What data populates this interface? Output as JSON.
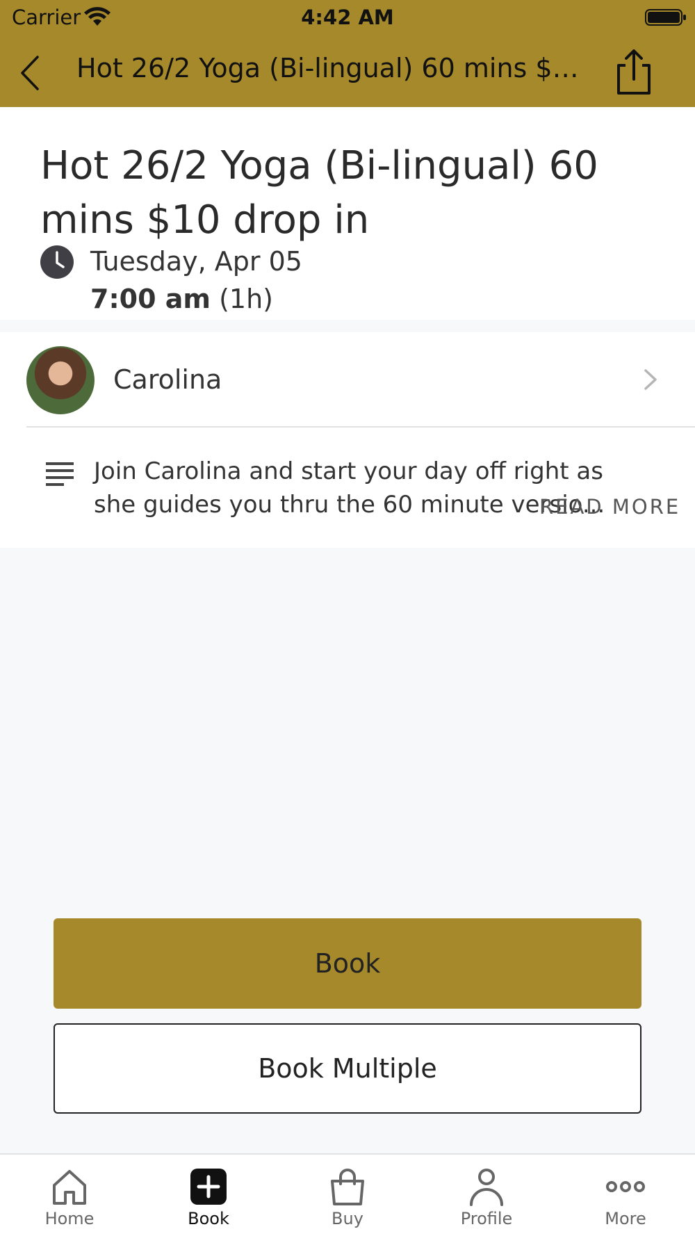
{
  "status_bar": {
    "carrier": "Carrier",
    "time": "4:42 AM"
  },
  "nav": {
    "title": "Hot 26/2 Yoga (Bi-lingual) 60 mins $10..."
  },
  "class": {
    "title": "Hot 26/2 Yoga (Bi-lingual) 60 mins $10 drop in",
    "date": "Tuesday, Apr 05",
    "time": "7:00 am",
    "duration": "(1h)"
  },
  "instructor": {
    "name": "Carolina"
  },
  "description": {
    "text": "Join Carolina and start your day off right as she guides you thru the 60 minute versio...",
    "read_more": "READ MORE"
  },
  "actions": {
    "book": "Book",
    "book_multiple": "Book Multiple"
  },
  "tabs": [
    {
      "label": "Home",
      "icon": "home-icon"
    },
    {
      "label": "Book",
      "icon": "book-plus-icon"
    },
    {
      "label": "Buy",
      "icon": "shopping-bag-icon"
    },
    {
      "label": "Profile",
      "icon": "person-icon"
    },
    {
      "label": "More",
      "icon": "more-dots-icon"
    }
  ],
  "colors": {
    "accent": "#a6892a"
  }
}
